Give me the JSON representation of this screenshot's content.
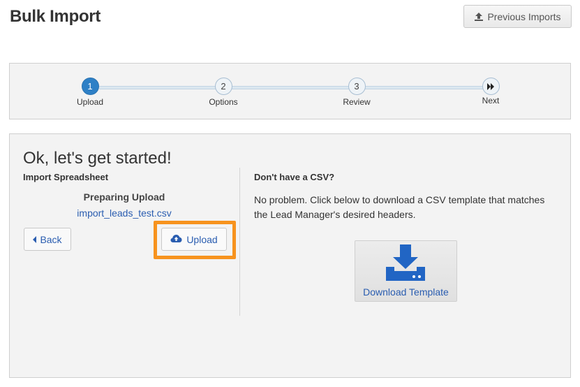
{
  "header": {
    "title": "Bulk Import",
    "previous_imports_label": "Previous Imports"
  },
  "steps": [
    {
      "number": "1",
      "label": "Upload",
      "active": true
    },
    {
      "number": "2",
      "label": "Options",
      "active": false
    },
    {
      "number": "3",
      "label": "Review",
      "active": false
    },
    {
      "number": "",
      "label": "Next",
      "active": false
    }
  ],
  "main": {
    "heading": "Ok, let's get started!",
    "left": {
      "subheading": "Import Spreadsheet",
      "status": "Preparing Upload",
      "file_name": "import_leads_test.csv",
      "back_label": "Back",
      "upload_label": "Upload"
    },
    "right": {
      "subheading": "Don't have a CSV?",
      "text": "No problem. Click below to download a CSV template that matches the Lead Manager's desired headers.",
      "download_label": "Download Template"
    }
  },
  "icons": {
    "upload_tray": "upload-icon",
    "back_caret": "caret-left-icon",
    "cloud_upload": "cloud-upload-icon",
    "fast_forward": "fast-forward-icon",
    "download_drive": "download-icon"
  },
  "colors": {
    "accent_blue": "#2e80c6",
    "link_blue": "#2a5db0",
    "highlight_orange": "#f7931e",
    "panel_bg": "#f3f3f3"
  }
}
